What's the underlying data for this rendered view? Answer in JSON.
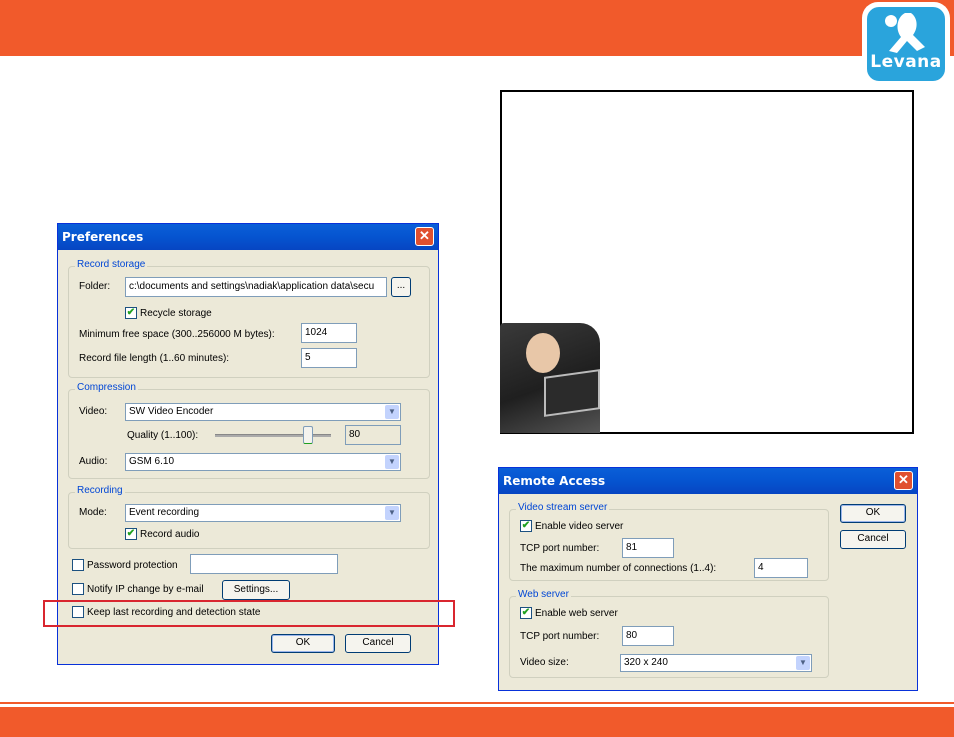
{
  "logo": {
    "text": "Levana"
  },
  "preferences": {
    "title": "Preferences",
    "record_storage": {
      "label": "Record storage",
      "folder_label": "Folder:",
      "folder_value": "c:\\documents and settings\\nadiak\\application data\\secu",
      "browse_label": "...",
      "recycle_label": "Recycle storage",
      "recycle_checked": true,
      "min_free_label": "Minimum free space (300..256000 M bytes):",
      "min_free_value": "1024",
      "file_length_label": "Record file length (1..60 minutes):",
      "file_length_value": "5"
    },
    "compression": {
      "label": "Compression",
      "video_label": "Video:",
      "video_value": "SW Video Encoder",
      "quality_label": "Quality (1..100):",
      "quality_value": "80",
      "quality_level": 80,
      "audio_label": "Audio:",
      "audio_value": "GSM 6.10"
    },
    "recording": {
      "label": "Recording",
      "mode_label": "Mode:",
      "mode_value": "Event recording",
      "record_audio_label": "Record audio",
      "record_audio_checked": true
    },
    "password_label": "Password protection",
    "password_value": "",
    "notify_label": "Notify IP change by e-mail",
    "settings_label": "Settings...",
    "keep_state_label": "Keep last recording and detection state",
    "ok_label": "OK",
    "cancel_label": "Cancel"
  },
  "remote_access": {
    "title": "Remote Access",
    "video_stream": {
      "label": "Video stream server",
      "enable_label": "Enable video server",
      "enable_checked": true,
      "tcp_label": "TCP port number:",
      "tcp_value": "81",
      "max_conn_label": "The maximum number of connections (1..4):",
      "max_conn_value": "4"
    },
    "web_server": {
      "label": "Web server",
      "enable_label": "Enable web server",
      "enable_checked": true,
      "tcp_label": "TCP port number:",
      "tcp_value": "80",
      "video_size_label": "Video size:",
      "video_size_value": "320 x 240"
    },
    "ok_label": "OK",
    "cancel_label": "Cancel"
  },
  "colors": {
    "brand_orange": "#f15a2b",
    "highlight_red": "#d9262f",
    "xp_blue": "#0554d0"
  }
}
